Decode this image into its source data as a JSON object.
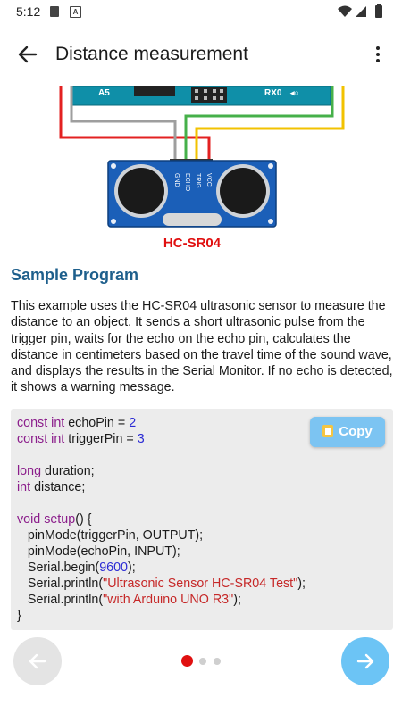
{
  "status_bar": {
    "time": "5:12",
    "sd_icon": "sd-card-icon",
    "a_icon": "A",
    "wifi_icon": "wifi-icon",
    "signal_icon": "cell-signal-icon",
    "battery_icon": "battery-icon"
  },
  "app_bar": {
    "title": "Distance measurement",
    "back_icon": "arrow-back-icon",
    "menu_icon": "more-vert-icon"
  },
  "diagram": {
    "board_labels": [
      "A5",
      "RX0"
    ],
    "sensor_pins": [
      "GND",
      "ECHO",
      "TRIG",
      "VCC"
    ],
    "caption": "HC-SR04"
  },
  "section": {
    "title": "Sample Program",
    "description": "This example uses the HC-SR04 ultrasonic sensor to measure the distance to an object. It sends a short ultrasonic pulse from the trigger pin, waits for the echo on the echo pin, calculates the distance in centimeters based on the travel time of the sound wave, and displays the results in the Serial Monitor. If no echo is detected, it shows a warning message."
  },
  "code": {
    "copy_label": "Copy",
    "copy_icon": "clipboard-icon",
    "lines": [
      [
        {
          "t": "const int",
          "c": "kw"
        },
        {
          "t": " echoPin = "
        },
        {
          "t": "2",
          "c": "num"
        }
      ],
      [
        {
          "t": "const int",
          "c": "kw"
        },
        {
          "t": " triggerPin = "
        },
        {
          "t": "3",
          "c": "num"
        }
      ],
      [],
      [
        {
          "t": "long",
          "c": "kw"
        },
        {
          "t": " duration;"
        }
      ],
      [
        {
          "t": "int",
          "c": "kw"
        },
        {
          "t": " distance;"
        }
      ],
      [],
      [
        {
          "t": "void setup",
          "c": "kw"
        },
        {
          "t": "() {"
        }
      ],
      [
        {
          "t": "   pinMode(triggerPin, OUTPUT);"
        }
      ],
      [
        {
          "t": "   pinMode(echoPin, INPUT);"
        }
      ],
      [
        {
          "t": "   Serial.begin("
        },
        {
          "t": "9600",
          "c": "num"
        },
        {
          "t": ");"
        }
      ],
      [
        {
          "t": "   Serial.println("
        },
        {
          "t": "\"Ultrasonic Sensor HC-SR04 Test\"",
          "c": "str"
        },
        {
          "t": ");"
        }
      ],
      [
        {
          "t": "   Serial.println("
        },
        {
          "t": "\"with Arduino UNO R3\"",
          "c": "str"
        },
        {
          "t": ");"
        }
      ],
      [
        {
          "t": "}"
        }
      ]
    ]
  },
  "pager": {
    "prev_icon": "arrow-left-icon",
    "next_icon": "arrow-right-icon",
    "page_count": 3,
    "current_page": 1
  },
  "colors": {
    "accent": "#1e5f8c",
    "next_button": "#6cc4f5",
    "copy_button": "#7cc4f2",
    "active_dot": "#e01010"
  }
}
